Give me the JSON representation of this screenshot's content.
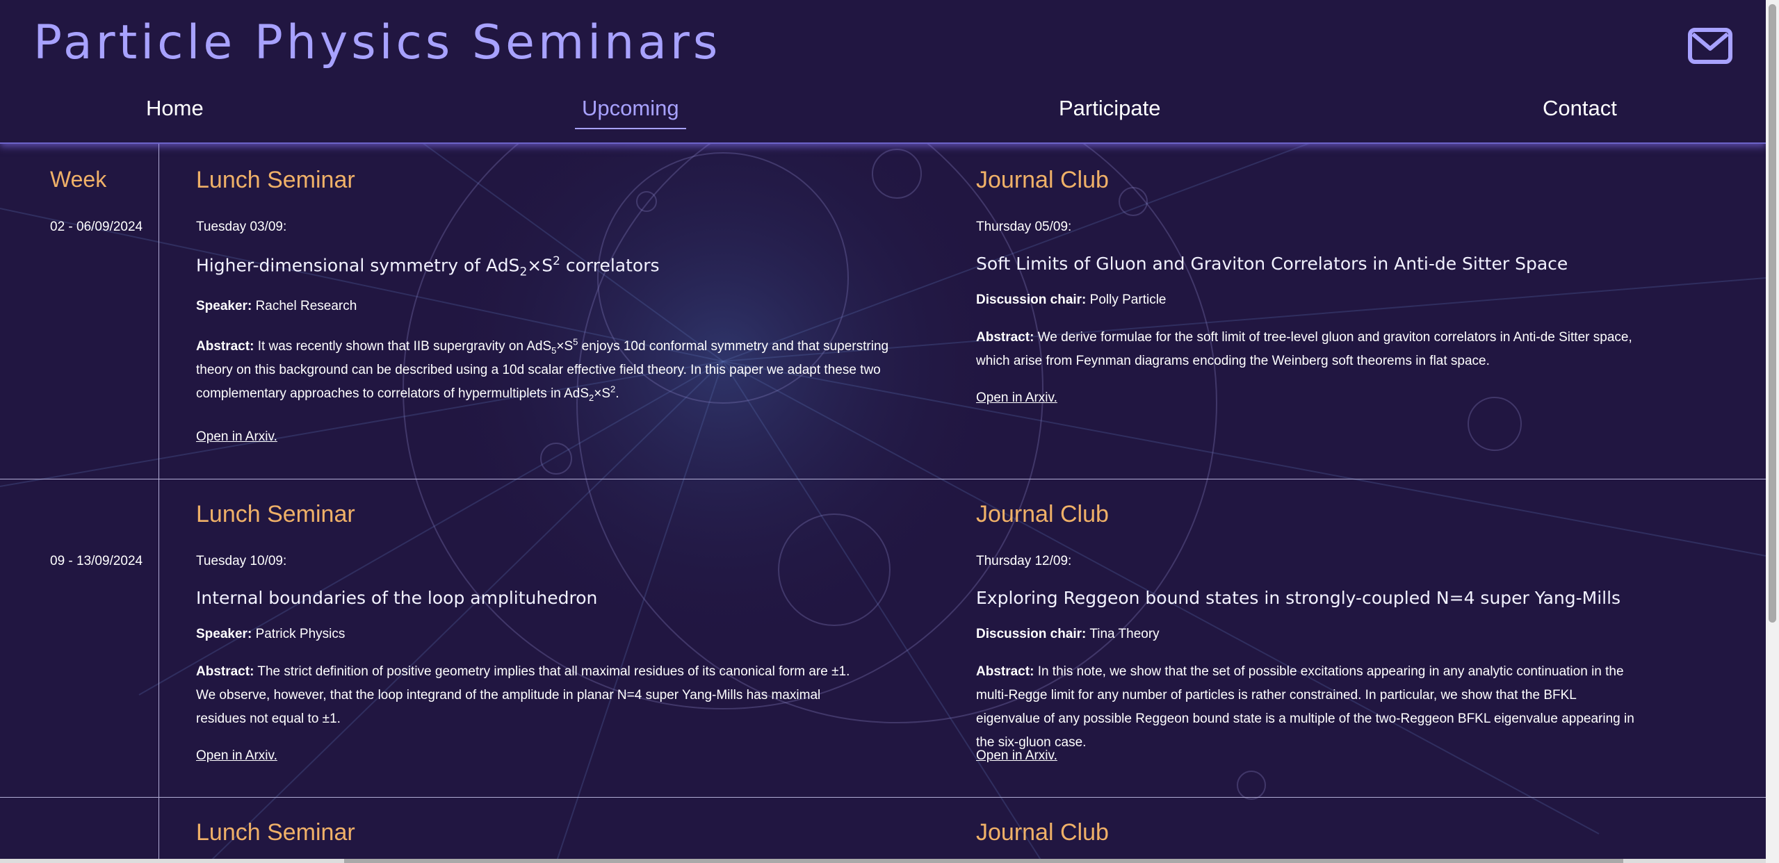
{
  "site": {
    "title": "Particle Physics Seminars",
    "mail_icon": "envelope-icon"
  },
  "nav": {
    "items": [
      {
        "label": "Home",
        "active": false
      },
      {
        "label": "Upcoming",
        "active": true
      },
      {
        "label": "Participate",
        "active": false
      },
      {
        "label": "Contact",
        "active": false
      }
    ]
  },
  "schedule": {
    "week_header": "Week",
    "weeks": [
      {
        "dates": "02 - 06/09/2024",
        "lunch": {
          "section": "Lunch Seminar",
          "day": "Tuesday 03/09:",
          "title_parts": [
            "Higher-dimensional symmetry of AdS",
            "2",
            "×S",
            "2",
            " correlators"
          ],
          "speaker_label": "Speaker:",
          "speaker": "Rachel Research",
          "abstract_label": "Abstract:",
          "abstract_parts": [
            "It was recently shown that IIB supergravity on AdS",
            "5",
            "×S",
            "5",
            " enjoys 10d conformal symmetry and that superstring theory on this background can be described using a 10d scalar effective field theory. In this paper we adapt these two complementary approaches to correlators of hypermultiplets in AdS",
            "2",
            "×S",
            "2",
            "."
          ],
          "link": "Open in Arxiv."
        },
        "journal": {
          "section": "Journal Club",
          "day": "Thursday 05/09:",
          "title": "Soft Limits of Gluon and Graviton Correlators in Anti-de Sitter Space",
          "chair_label": "Discussion chair:",
          "chair": "Polly Particle",
          "abstract_label": "Abstract:",
          "abstract": "We derive formulae for the soft limit of tree-level gluon and graviton correlators in Anti-de Sitter space, which arise from Feynman diagrams encoding the Weinberg soft theorems in flat space.",
          "link": "Open in Arxiv."
        }
      },
      {
        "dates": "09 - 13/09/2024",
        "lunch": {
          "section": "Lunch Seminar",
          "day": "Tuesday 10/09:",
          "title": "Internal boundaries of the loop amplituhedron",
          "speaker_label": "Speaker:",
          "speaker": "Patrick Physics",
          "abstract_label": "Abstract:",
          "abstract": "The strict definition of positive geometry implies that all maximal residues of its canonical form are ±1. We observe, however, that the loop integrand of the amplitude in planar N=4 super Yang-Mills has maximal residues not equal to ±1.",
          "link": "Open in Arxiv."
        },
        "journal": {
          "section": "Journal Club",
          "day": "Thursday 12/09:",
          "title": "Exploring Reggeon bound states in strongly-coupled N=4 super Yang-Mills",
          "chair_label": "Discussion chair:",
          "chair": "Tina Theory",
          "abstract_label": "Abstract:",
          "abstract": "In this note, we show that the set of possible excitations appearing in any analytic continuation in the multi-Regge limit for any number of particles is rather constrained. In particular, we show that the BFKL eigenvalue of any possible Reggeon bound state is a multiple of the two-Reggeon BFKL eigenvalue appearing in the six-gluon case.",
          "link": "Open in Arxiv."
        }
      },
      {
        "lunch": {
          "section": "Lunch Seminar"
        },
        "journal": {
          "section": "Journal Club"
        }
      }
    ]
  },
  "colors": {
    "background": "#211641",
    "accent": "#a8a2ff",
    "section": "#f0b168",
    "text": "#ffffff"
  }
}
